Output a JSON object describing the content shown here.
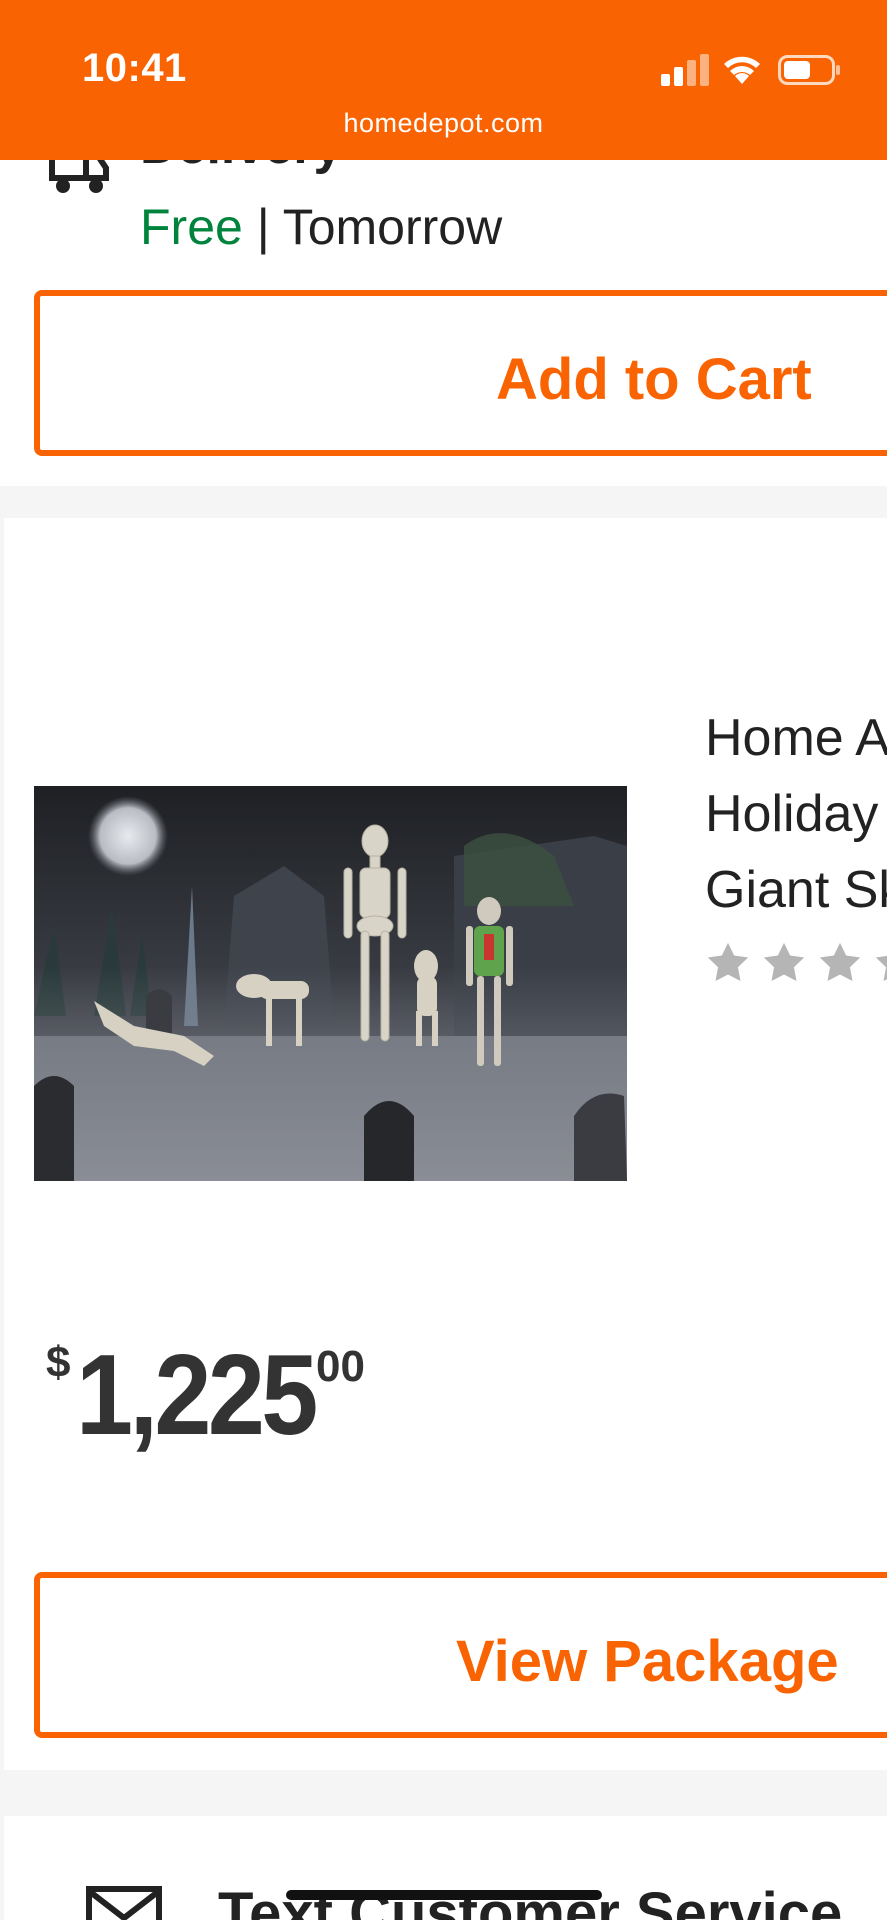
{
  "status_bar": {
    "time": "10:41",
    "url": "homedepot.com",
    "icons": [
      "cellular-signal-icon",
      "wifi-icon",
      "battery-icon"
    ],
    "color": "#f96302"
  },
  "delivery": {
    "label": "Delivery",
    "price": "Free",
    "separator": "|",
    "when": "Tomorrow",
    "icon": "truck-icon",
    "free_color": "#00843d"
  },
  "add_to_cart": {
    "label": "Add to Cart"
  },
  "product": {
    "image_icon": "halloween-skeleton-scene",
    "title_lines": [
      "Home A",
      "Holiday",
      "Giant Sk"
    ],
    "rating_icon": "star-icon",
    "price": {
      "currency": "$",
      "dollars": "1,225",
      "cents": "00"
    },
    "view_package": "View Package"
  },
  "text_service": {
    "icon": "mail-icon",
    "label": "Text Customer Service"
  },
  "accent_color": "#f96302"
}
